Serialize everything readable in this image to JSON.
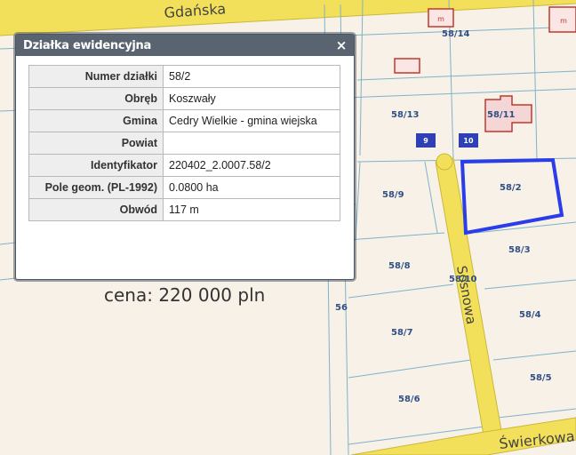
{
  "popup": {
    "title": "Działka ewidencyjna",
    "close_symbol": "×",
    "rows": [
      {
        "label": "Numer działki",
        "value": "58/2"
      },
      {
        "label": "Obręb",
        "value": "Koszwały"
      },
      {
        "label": "Gmina",
        "value": "Cedry Wielkie - gmina wiejska"
      },
      {
        "label": "Powiat",
        "value": ""
      },
      {
        "label": "Identyfikator",
        "value": "220402_2.0007.58/2"
      },
      {
        "label": "Pole geom. (PL-1992)",
        "value": "0.0800 ha"
      },
      {
        "label": "Obwód",
        "value": "117 m"
      }
    ]
  },
  "price_caption": "cena: 220 000 pln",
  "map": {
    "streets": {
      "gdanska": "Gdańska",
      "sosnowa": "Sosnowa",
      "swierkowa": "Świerkowa"
    },
    "parcels": {
      "p58_14": "58/14",
      "p58_13": "58/13",
      "p58_11": "58/11",
      "p58_9": "58/9",
      "p58_2": "58/2",
      "p58_3": "58/3",
      "p58_8": "58/8",
      "p58_10": "58/10",
      "p58_4": "58/4",
      "p58_7": "58/7",
      "p58_5": "58/5",
      "p58_6": "58/6",
      "p56": "56"
    },
    "address_numbers": {
      "n9": "9",
      "n10": "10"
    },
    "colors": {
      "highlight": "#2a3de8",
      "road": "#f3e05a",
      "parcel_line": "#7fb3c8",
      "building": "#c0392b",
      "address_box": "#2f3fb5"
    }
  }
}
